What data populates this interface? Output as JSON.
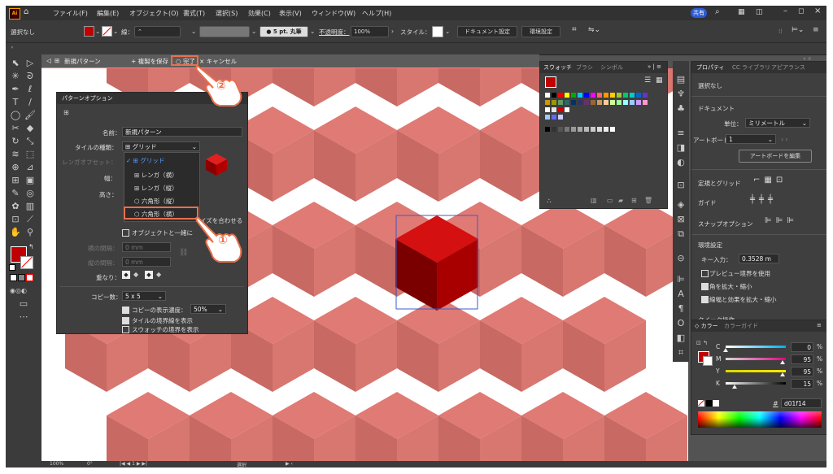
{
  "menubar": {
    "items": [
      "ファイル(F)",
      "編集(E)",
      "オブジェクト(O)",
      "書式(T)",
      "選択(S)",
      "効果(C)",
      "表示(V)",
      "ウィンドウ(W)",
      "ヘルプ(H)"
    ],
    "share": "共有"
  },
  "control": {
    "selection": "選択なし",
    "stroke_label": "線：",
    "brush": "5 pt. 丸筆",
    "opacity_label": "不透明度：",
    "opacity": "100%",
    "style_label": "スタイル：",
    "doc_settings": "ドキュメント設定",
    "env_settings": "環境設定"
  },
  "isolation": {
    "name": "新規パターン",
    "save_copy": "+ 複製を保存",
    "done": "完了",
    "cancel": "キャンセル"
  },
  "pattern_options": {
    "title": "パターンオプション",
    "name_label": "名前：",
    "name_value": "新規パターン",
    "tile_type_label": "タイルの種類：",
    "tile_type_value": "グリッド",
    "offset_label": "レンガオフセット：",
    "width_label": "幅：",
    "height_label": "高さ：",
    "tile_menu": [
      "グリッド",
      "レンガ（横）",
      "レンガ（縦）",
      "六角形（縦）",
      "六角形（横）"
    ],
    "size_suffix": "イズを合わせる",
    "move_tile": "オブジェクトと一緒に",
    "h_spacing": "横の間隔：",
    "v_spacing": "縦の間隔：",
    "mm": "0 mm",
    "overlap_label": "重なり：",
    "copies_label": "コピー数：",
    "copies_value": "5 x 5",
    "dim_copies": "コピーの表示濃度：",
    "dim_value": "50%",
    "show_tile_edge": "タイルの境界線を表示",
    "show_swatch_bounds": "スウォッチの境界を表示"
  },
  "swatch_panel": {
    "tabs": [
      "スウォッチ",
      "ブラシ",
      "シンボル"
    ]
  },
  "properties": {
    "tabs": [
      "プロパティ",
      "CC ライブラリ",
      "アピアランス"
    ],
    "selection": "選択なし",
    "document": "ドキュメント",
    "unit_label": "単位：",
    "unit_value": "ミリメートル",
    "artboard_label": "アートボード：",
    "artboard_value": "1",
    "edit_artboard": "アートボードを編集",
    "rulers": "定規とグリッド",
    "guides": "ガイド",
    "snap": "スナップオプション",
    "prefs": "環境設定",
    "key_label": "キー入力：",
    "key_value": "0.3528 m",
    "preview_bounds": "プレビュー境界を使用",
    "scale_corners": "角を拡大・縮小",
    "scale_strokes": "線幅と効果を拡大・縮小",
    "quick": "クイック操作"
  },
  "color_panel": {
    "tabs": [
      "カラー",
      "カラーガイド"
    ],
    "channels": [
      {
        "label": "C",
        "value": "0",
        "pct": "%",
        "level": 0
      },
      {
        "label": "M",
        "value": "95",
        "pct": "%",
        "level": 0.95
      },
      {
        "label": "Y",
        "value": "95",
        "pct": "%",
        "level": 0.95
      },
      {
        "label": "K",
        "value": "15",
        "pct": "%",
        "level": 0.15
      }
    ],
    "hex": "d01f14"
  },
  "status": {
    "zoom": "100%",
    "rotation": "0°",
    "artboard": "1",
    "tool": "選択"
  },
  "annotations": {
    "step1": "①",
    "step2": "②"
  },
  "colors": {
    "cube_top": "#e07a74",
    "cube_left": "#c86963",
    "cube_right": "#d87670",
    "accent": "#c00000",
    "callout": "#e8704c"
  }
}
